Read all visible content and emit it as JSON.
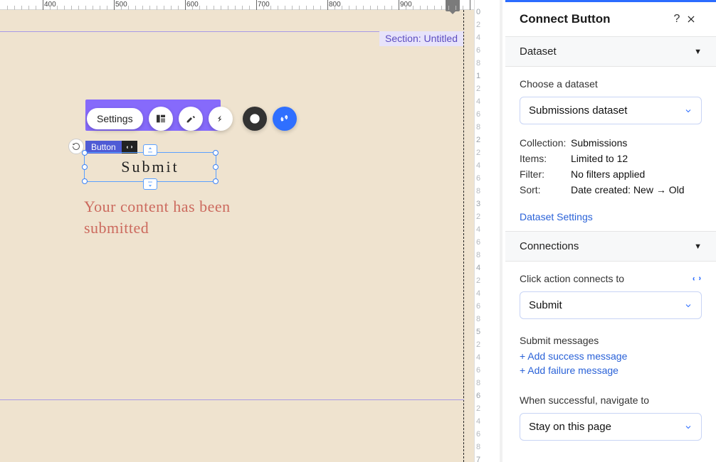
{
  "ruler": {
    "ticks": [
      "400",
      "500",
      "600",
      "700",
      "800",
      "900"
    ]
  },
  "section": {
    "label": "Section: Untitled"
  },
  "toolbar": {
    "settings_label": "Settings"
  },
  "element": {
    "chip_label": "Button",
    "text": "Submit"
  },
  "ghost": {
    "text": "Your content has been submitted"
  },
  "side_ruler": {
    "majors": [
      "0",
      "1",
      "2",
      "3",
      "4",
      "5",
      "6",
      "7"
    ],
    "minors": [
      "2",
      "4",
      "6",
      "8",
      "0"
    ]
  },
  "panel": {
    "title": "Connect Button",
    "dataset_section": "Dataset",
    "choose_label": "Choose a dataset",
    "dataset_value": "Submissions dataset",
    "meta": {
      "collection_k": "Collection:",
      "collection_v": "Submissions",
      "items_k": "Items:",
      "items_v": "Limited to 12",
      "filter_k": "Filter:",
      "filter_v": "No filters applied",
      "sort_k": "Sort:",
      "sort_v": "Date created: New → Old"
    },
    "dataset_settings": "Dataset Settings",
    "connections_section": "Connections",
    "click_label": "Click action connects to",
    "click_value": "Submit",
    "submit_msgs_label": "Submit messages",
    "add_success": "Add success message",
    "add_failure": "Add failure message",
    "nav_label": "When successful, navigate to",
    "nav_value": "Stay on this page"
  }
}
